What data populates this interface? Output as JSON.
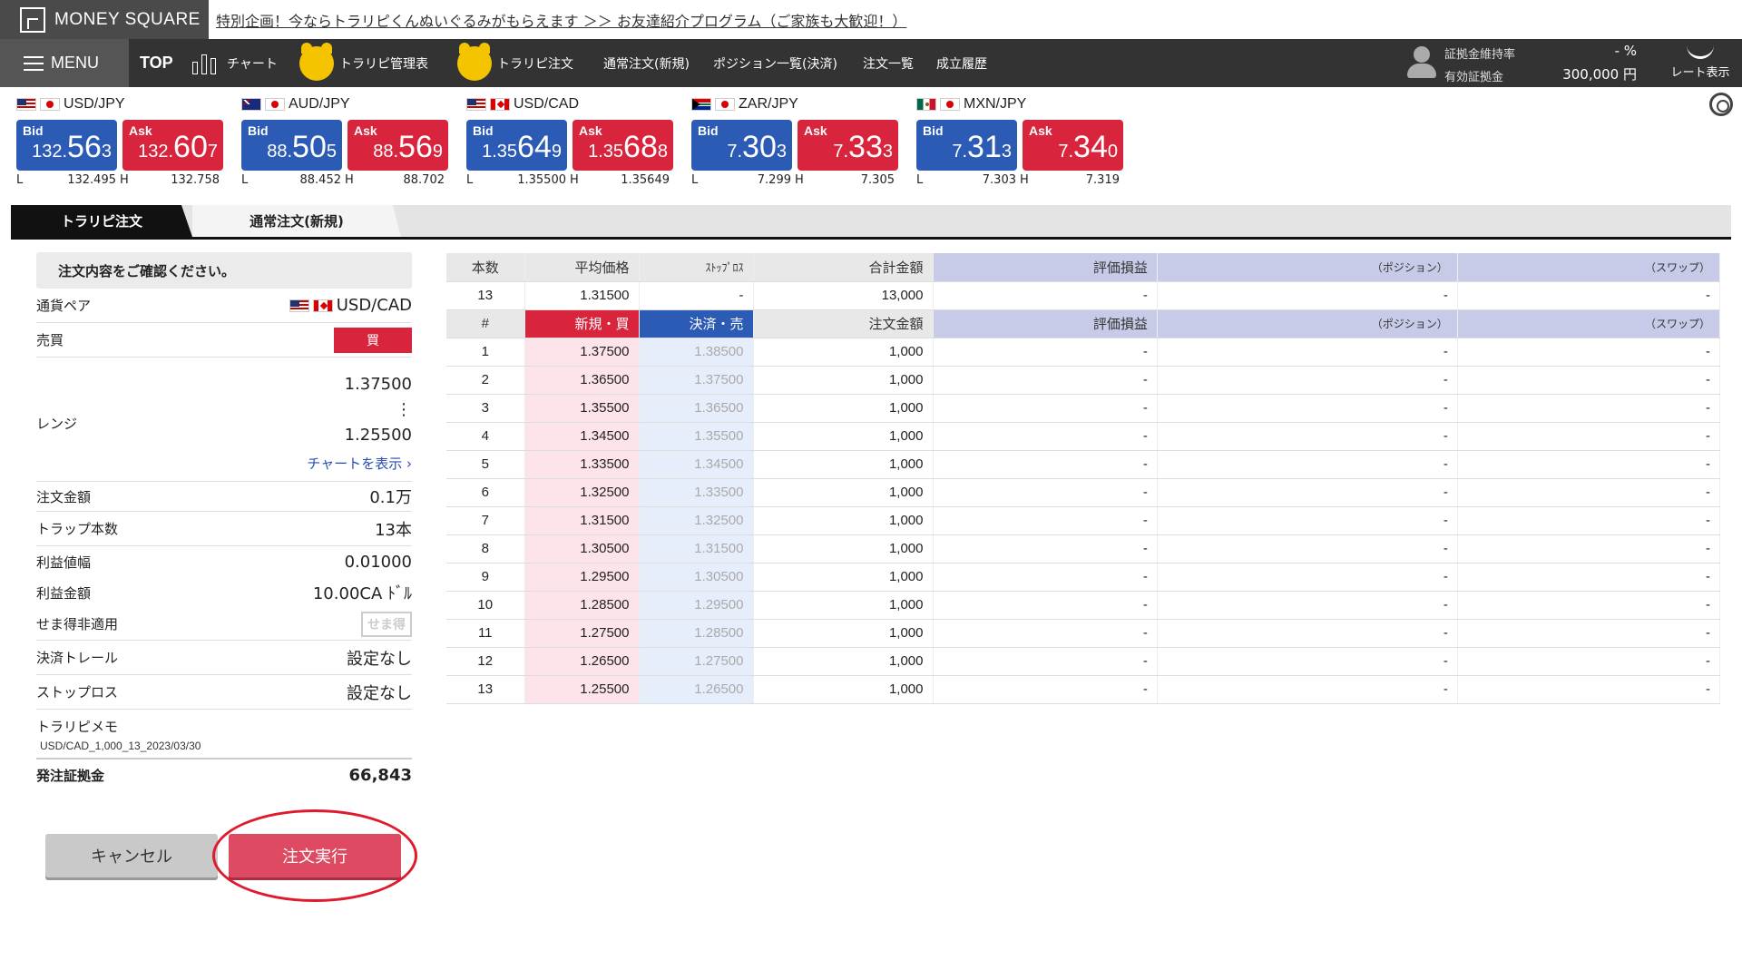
{
  "header": {
    "logo": "MONEY SQUARE",
    "promo": "特別企画！今ならトラリピくんぬいぐるみがもらえます ＞＞ お友達紹介プログラム（ご家族も大歓迎！）"
  },
  "nav": {
    "menu": "MENU",
    "top": "TOP",
    "chart": "チャート",
    "trap_manage": "トラリピ管理表",
    "trap_order": "トラリピ注文",
    "normal_order": "通常注文(新規)",
    "positions": "ポジション一覧(決済)",
    "orders": "注文一覧",
    "history": "成立履歴",
    "account": {
      "margin_ratio_label": "証拠金維持率",
      "margin_ratio_value": "- %",
      "effective_margin_label": "有効証拠金",
      "effective_margin_value": "300,000 円"
    },
    "rate_toggle": "レート表示"
  },
  "rates": [
    {
      "pair": "USD/JPY",
      "flag": "flag-us",
      "bid": [
        "132.",
        "56",
        "3"
      ],
      "ask": [
        "132.",
        "60",
        "7"
      ],
      "low": "132.495",
      "high": "132.758"
    },
    {
      "pair": "AUD/JPY",
      "flag": "flag-au",
      "bid": [
        "88.",
        "50",
        "5"
      ],
      "ask": [
        "88.",
        "56",
        "9"
      ],
      "low": "88.452",
      "high": "88.702"
    },
    {
      "pair": "USD/CAD",
      "flag": "flag-us",
      "flag2": "flag-ca",
      "bid": [
        "1.35",
        "64",
        "9"
      ],
      "ask": [
        "1.35",
        "68",
        "8"
      ],
      "low": "1.35500",
      "high": "1.35649"
    },
    {
      "pair": "ZAR/JPY",
      "flag": "flag-za",
      "bid": [
        "7.",
        "30",
        "3"
      ],
      "ask": [
        "7.",
        "33",
        "3"
      ],
      "low": "7.299",
      "high": "7.305"
    },
    {
      "pair": "MXN/JPY",
      "flag": "flag-mx",
      "bid": [
        "7.",
        "31",
        "3"
      ],
      "ask": [
        "7.",
        "34",
        "0"
      ],
      "low": "7.303",
      "high": "7.319"
    }
  ],
  "labels": {
    "bid": "Bid",
    "ask": "Ask",
    "low": "L",
    "high": "H"
  },
  "tabs": {
    "active": "トラリピ注文",
    "inactive": "通常注文(新規)"
  },
  "confirm": {
    "title": "注文内容をご確認ください。",
    "pair_label": "通貨ペア",
    "pair_value": "USD/CAD",
    "side_label": "売買",
    "side_value": "買",
    "range_label": "レンジ",
    "range_high": "1.37500",
    "range_sep": "⋮",
    "range_low": "1.25500",
    "chart_link": "チャートを表示 ›",
    "amount_label": "注文金額",
    "amount_value": "0.1万",
    "traps_label": "トラップ本数",
    "traps_value": "13本",
    "profit_width_label": "利益値幅",
    "profit_width_value": "0.01000",
    "profit_amount_label": "利益金額",
    "profit_amount_value": "10.00CA ﾄﾞﾙ",
    "sema_label": "せま得非適用",
    "sema_badge": "せま得",
    "trail_label": "決済トレール",
    "trail_value": "設定なし",
    "stop_label": "ストップロス",
    "stop_value": "設定なし",
    "memo_label": "トラリピメモ",
    "memo_value": "USD/CAD_1,000_13_2023/03/30",
    "margin_label": "発注証拠金",
    "margin_value": "66,843",
    "cancel": "キャンセル",
    "execute": "注文実行"
  },
  "summary_table": {
    "headers": [
      "本数",
      "平均価格",
      "ｽﾄｯﾌﾟﾛｽ",
      "合計金額",
      "評価損益",
      "（ポジション）",
      "（スワップ）"
    ],
    "row": [
      "13",
      "1.31500",
      "-",
      "13,000",
      "-",
      "-",
      "-"
    ]
  },
  "detail_table": {
    "headers": [
      "#",
      "新規・買",
      "決済・売",
      "注文金額",
      "評価損益",
      "（ポジション）",
      "（スワップ）"
    ],
    "rows": [
      [
        "1",
        "1.37500",
        "1.38500",
        "1,000",
        "-",
        "-",
        "-"
      ],
      [
        "2",
        "1.36500",
        "1.37500",
        "1,000",
        "-",
        "-",
        "-"
      ],
      [
        "3",
        "1.35500",
        "1.36500",
        "1,000",
        "-",
        "-",
        "-"
      ],
      [
        "4",
        "1.34500",
        "1.35500",
        "1,000",
        "-",
        "-",
        "-"
      ],
      [
        "5",
        "1.33500",
        "1.34500",
        "1,000",
        "-",
        "-",
        "-"
      ],
      [
        "6",
        "1.32500",
        "1.33500",
        "1,000",
        "-",
        "-",
        "-"
      ],
      [
        "7",
        "1.31500",
        "1.32500",
        "1,000",
        "-",
        "-",
        "-"
      ],
      [
        "8",
        "1.30500",
        "1.31500",
        "1,000",
        "-",
        "-",
        "-"
      ],
      [
        "9",
        "1.29500",
        "1.30500",
        "1,000",
        "-",
        "-",
        "-"
      ],
      [
        "10",
        "1.28500",
        "1.29500",
        "1,000",
        "-",
        "-",
        "-"
      ],
      [
        "11",
        "1.27500",
        "1.28500",
        "1,000",
        "-",
        "-",
        "-"
      ],
      [
        "12",
        "1.26500",
        "1.27500",
        "1,000",
        "-",
        "-",
        "-"
      ],
      [
        "13",
        "1.25500",
        "1.26500",
        "1,000",
        "-",
        "-",
        "-"
      ]
    ]
  },
  "colors": {
    "bid": "#2b5bb5",
    "ask": "#d8243c",
    "exec_button": "#dd4a62",
    "highlight_ring": "#e0192c"
  }
}
